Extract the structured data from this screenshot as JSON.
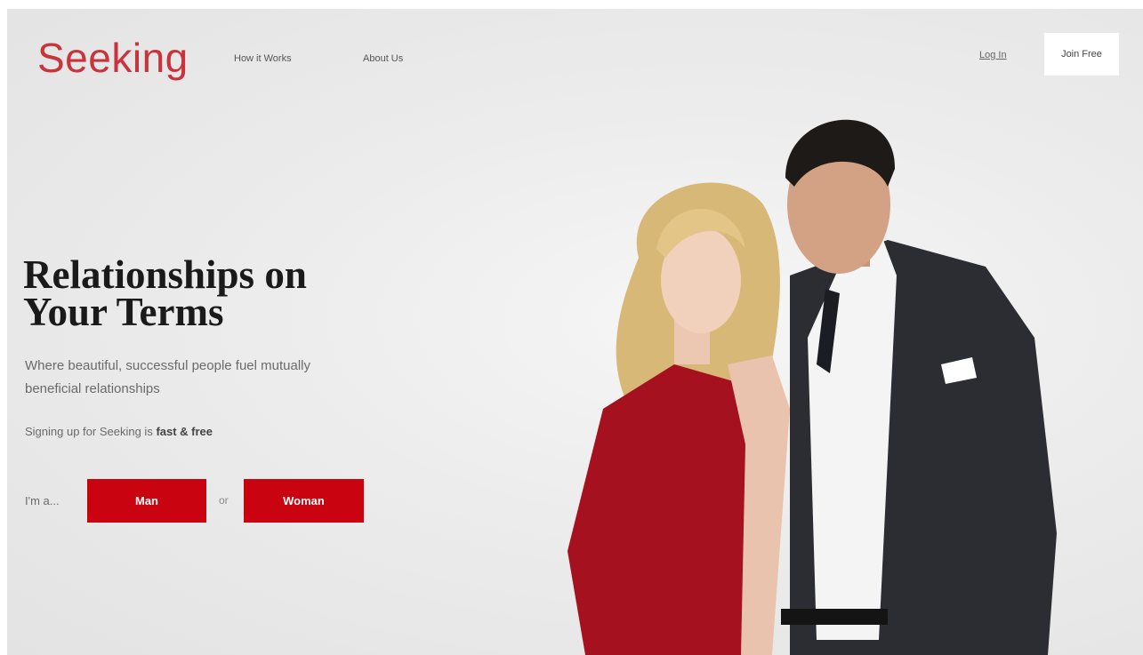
{
  "header": {
    "logo": "Seeking",
    "nav": {
      "how_it_works": "How it Works",
      "about_us": "About Us"
    },
    "login": "Log In",
    "join": "Join Free"
  },
  "hero": {
    "title": "Relationships on Your Terms",
    "subtitle": "Where beautiful, successful people fuel mutually beneficial relationships",
    "signup_prefix": "Signing up for Seeking is ",
    "signup_emphasis": "fast & free",
    "im_label": "I'm a...",
    "man_button": "Man",
    "or": "or",
    "woman_button": "Woman"
  },
  "colors": {
    "brand_red": "#c9343c",
    "button_red": "#c9030f",
    "background": "#e9e9e9"
  }
}
